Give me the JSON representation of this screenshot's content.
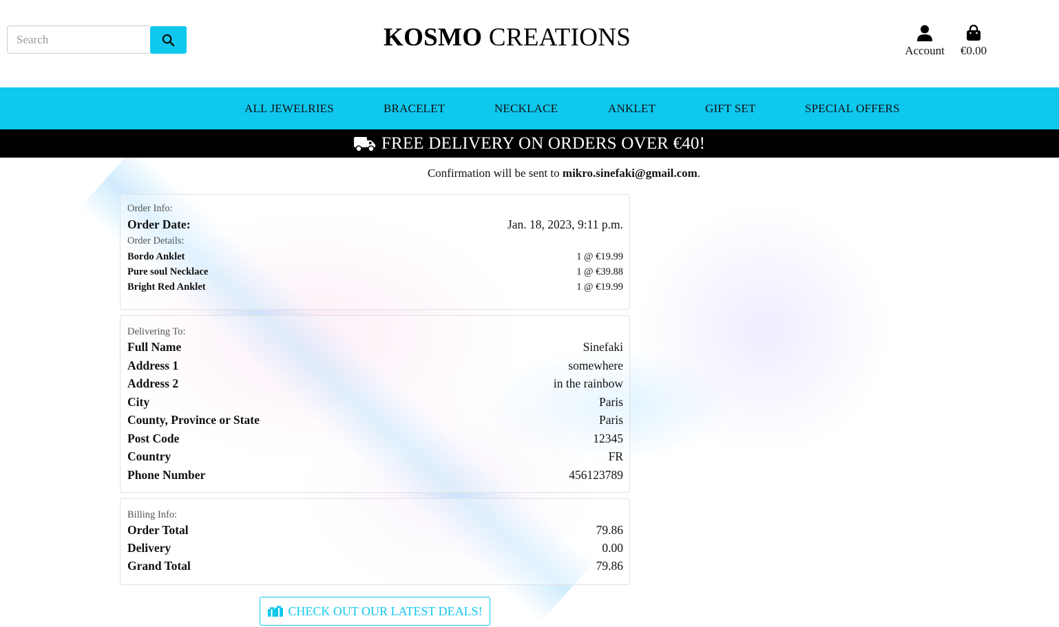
{
  "search": {
    "placeholder": "Search"
  },
  "brand": {
    "bold": "KOSMO",
    "rest": "CREATIONS"
  },
  "header": {
    "account_label": "Account",
    "bag_total": "€0.00"
  },
  "nav": {
    "items": [
      "ALL JEWELRIES",
      "BRACELET",
      "NECKLACE",
      "ANKLET",
      "GIFT SET",
      "SPECIAL OFFERS"
    ]
  },
  "banner": {
    "text": "FREE DELIVERY ON ORDERS OVER €40!"
  },
  "confirmation": {
    "prefix": "Confirmation will be sent to",
    "email": "mikro.sinefaki@gmail.com",
    "suffix": "."
  },
  "order_info": {
    "label": "Order Info:",
    "date_key": "Order Date:",
    "date_value": "Jan. 18, 2023, 9:11 p.m.",
    "details_label": "Order Details:",
    "items": [
      {
        "name": "Bordo Anklet",
        "qty_price": "1 @ €19.99"
      },
      {
        "name": "Pure soul Necklace",
        "qty_price": "1 @ €39.88"
      },
      {
        "name": "Bright Red Anklet",
        "qty_price": "1 @ €19.99"
      }
    ]
  },
  "delivering_to": {
    "label": "Delivering To:",
    "rows": [
      {
        "key": "Full Name",
        "value": "Sinefaki"
      },
      {
        "key": "Address 1",
        "value": "somewhere"
      },
      {
        "key": "Address 2",
        "value": "in the rainbow"
      },
      {
        "key": "City",
        "value": "Paris"
      },
      {
        "key": "County, Province or State",
        "value": "Paris"
      },
      {
        "key": "Post Code",
        "value": "12345"
      },
      {
        "key": "Country",
        "value": "FR"
      },
      {
        "key": "Phone Number",
        "value": "456123789"
      }
    ]
  },
  "billing": {
    "label": "Billing Info:",
    "rows": [
      {
        "key": "Order Total",
        "value": "79.86"
      },
      {
        "key": "Delivery",
        "value": "0.00"
      },
      {
        "key": "Grand Total",
        "value": "79.86"
      }
    ]
  },
  "deals_button": {
    "label": "CHECK OUT OUR LATEST DEALS!"
  },
  "colors": {
    "accent": "#0ec8ee",
    "banner_bg": "#000000"
  }
}
